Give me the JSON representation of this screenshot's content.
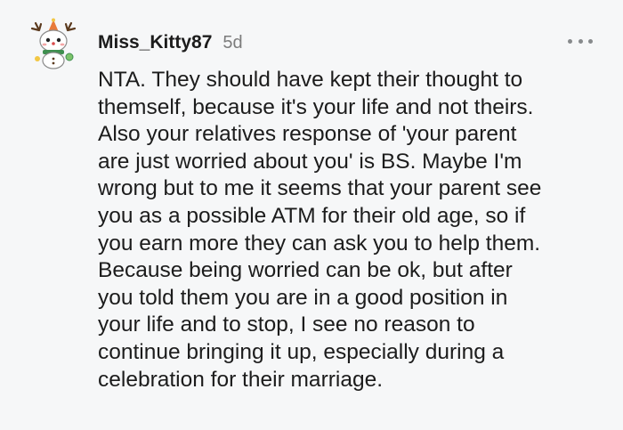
{
  "comment": {
    "username": "Miss_Kitty87",
    "timestamp": "5d",
    "avatar_icon": "snow-creature-avatar-icon",
    "more_icon": "more-options-icon",
    "lines": [
      "NTA. They should have kept their thought to",
      "themself, because it's your life and not theirs.",
      "Also your relatives response of 'your parent",
      "are just worried about you' is BS. Maybe I'm",
      "wrong but to me it seems that your parent see",
      "you as a possible ATM for their old age, so if",
      "you earn more they can ask you to help them.",
      "Because being worried can be ok, but after",
      "you told them you are in a good position in",
      "your life and to stop, I see no reason to",
      "continue bringing it up, especially during a",
      "celebration for their marriage."
    ]
  },
  "colors": {
    "background": "#f6f7f8",
    "text": "#1c1c1c",
    "muted": "#7c7c7c"
  }
}
